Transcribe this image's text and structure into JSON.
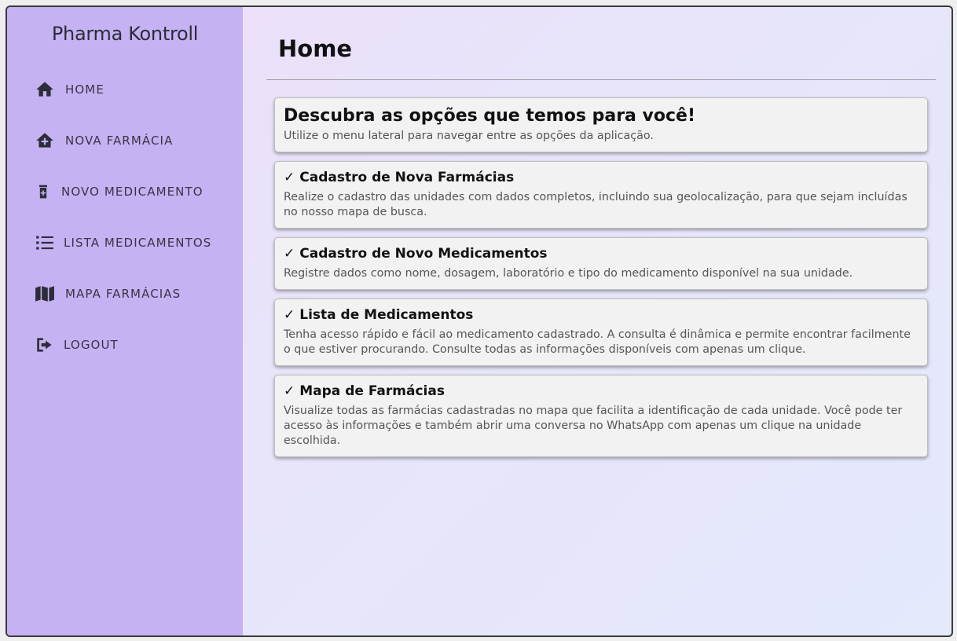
{
  "app": {
    "brand": "Pharma Kontroll"
  },
  "sidebar": {
    "items": [
      {
        "label": "HOME",
        "icon": "home-icon"
      },
      {
        "label": "NOVA FARMÁCIA",
        "icon": "house-plus-icon"
      },
      {
        "label": "NOVO MEDICAMENTO",
        "icon": "medicine-bottle-icon"
      },
      {
        "label": "LISTA MEDICAMENTOS",
        "icon": "list-icon"
      },
      {
        "label": "MAPA FARMÁCIAS",
        "icon": "map-icon"
      },
      {
        "label": "LOGOUT",
        "icon": "logout-icon"
      }
    ]
  },
  "main": {
    "title": "Home",
    "intro": {
      "heading": "Descubra as opções que temos para você!",
      "text": "Utilize o menu lateral para navegar entre as opções da aplicação."
    },
    "cards": [
      {
        "icon": "check-icon",
        "title": "Cadastro de Nova Farmácias",
        "text": "Realize o cadastro das unidades com dados completos, incluindo sua geolocalização, para que sejam incluídas no nosso mapa de busca."
      },
      {
        "icon": "check-icon",
        "title": "Cadastro de Novo Medicamentos",
        "text": "Registre dados como nome, dosagem, laboratório e tipo do medicamento disponível na sua unidade."
      },
      {
        "icon": "check-icon",
        "title": "Lista de Medicamentos",
        "text": "Tenha acesso rápido e fácil ao medicamento cadastrado. A consulta é dinâmica e permite encontrar facilmente o que estiver procurando. Consulte todas as informações disponíveis com apenas um clique."
      },
      {
        "icon": "check-icon",
        "title": "Mapa de Farmácias",
        "text": "Visualize todas as farmácias cadastradas no mapa que facilita a identificação de cada unidade. Você pode ter acesso às informações e também abrir uma conversa no WhatsApp com apenas um clique na unidade escolhida."
      }
    ]
  },
  "colors": {
    "sidebar_bg": "#c5b2f2",
    "card_bg": "#f2f2f2",
    "text_dark": "#111111"
  }
}
